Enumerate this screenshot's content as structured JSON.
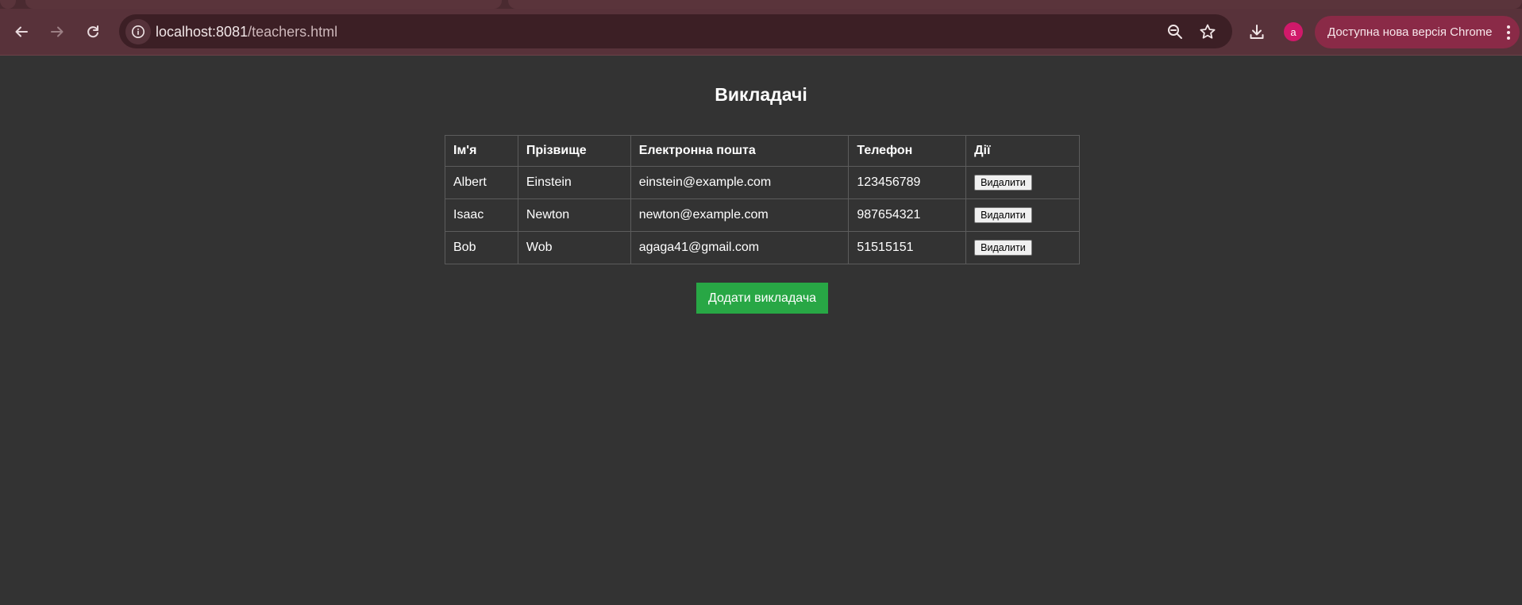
{
  "browser": {
    "url_host": "localhost:8081",
    "url_path": "/teachers.html",
    "profile_initial": "a",
    "update_label": "Доступна нова версія Chrome",
    "icons": {
      "back": "arrow-left-icon",
      "forward": "arrow-right-icon",
      "reload": "reload-icon",
      "site_info": "info-icon",
      "zoom": "zoom-out-icon",
      "bookmark": "star-icon",
      "downloads": "download-icon",
      "menu": "kebab-menu-icon"
    },
    "colors": {
      "toolbar": "#58323a",
      "omnibox": "#3c1f25",
      "avatar": "#d0196a",
      "update_pill": "#8a2a47"
    }
  },
  "page": {
    "title": "Викладачі",
    "table": {
      "headers": [
        "Ім'я",
        "Прізвище",
        "Електронна пошта",
        "Телефон",
        "Дії"
      ],
      "rows": [
        {
          "first_name": "Albert",
          "last_name": "Einstein",
          "email": "einstein@example.com",
          "phone": "123456789",
          "action": "Видалити"
        },
        {
          "first_name": "Isaac",
          "last_name": "Newton",
          "email": "newton@example.com",
          "phone": "987654321",
          "action": "Видалити"
        },
        {
          "first_name": "Bob",
          "last_name": "Wob",
          "email": "agaga41@gmail.com",
          "phone": "51515151",
          "action": "Видалити"
        }
      ]
    },
    "add_button_label": "Додати викладача",
    "colors": {
      "background": "#333333",
      "add_button": "#28a745"
    }
  }
}
